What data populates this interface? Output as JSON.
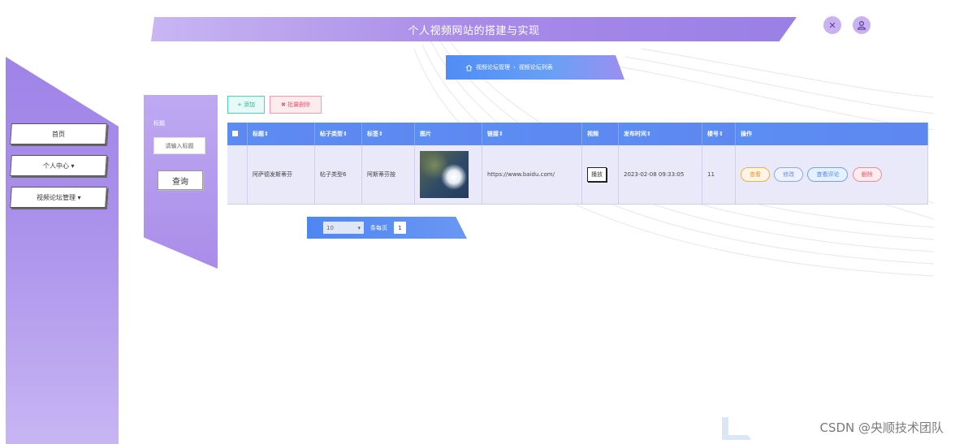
{
  "header": {
    "title": "个人视频网站的搭建与实现"
  },
  "sidebar": {
    "items": [
      {
        "label": "首页"
      },
      {
        "label": "个人中心 ▾"
      },
      {
        "label": "视频论坛管理 ▾"
      }
    ]
  },
  "search": {
    "label": "标题",
    "placeholder": "请输入标题",
    "button": "查询"
  },
  "breadcrumb": {
    "home": "视频论坛管理",
    "separator": "›",
    "current": "视频论坛列表"
  },
  "toolbar": {
    "add": "+ 添加",
    "bulk_delete": "✖ 批量删除"
  },
  "table": {
    "headers": [
      "标题⇕",
      "帖子类型⇕",
      "标签⇕",
      "图片",
      "链接⇕",
      "视频",
      "发布时间⇕",
      "楼号⇕",
      "操作"
    ],
    "rows": [
      {
        "title": "阿萨德发斯蒂芬",
        "type": "帖子类型6",
        "tag": "阿斯蒂芬按",
        "link": "https://www.baidu.com/",
        "video_btn": "播放",
        "time": "2023-02-08 09:33:05",
        "floor": "11",
        "ops": [
          "查看",
          "修改",
          "查看评论",
          "删除"
        ]
      }
    ]
  },
  "pagination": {
    "page_size": "10",
    "label": "条每页",
    "current_page": "1"
  },
  "watermark": "CSDN @央顺技术团队",
  "colors": {
    "accent": "#9f83e8",
    "table_header": "#5b8ef3",
    "row_bg": "#e9e9f9"
  }
}
